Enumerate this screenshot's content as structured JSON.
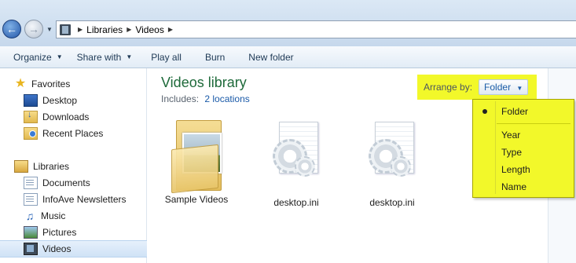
{
  "address": {
    "breadcrumb": [
      "Libraries",
      "Videos"
    ]
  },
  "toolbar": {
    "organize": "Organize",
    "share_with": "Share with",
    "play_all": "Play all",
    "burn": "Burn",
    "new_folder": "New folder"
  },
  "sidebar": {
    "favorites": "Favorites",
    "desktop": "Desktop",
    "downloads": "Downloads",
    "recent_places": "Recent Places",
    "libraries": "Libraries",
    "documents": "Documents",
    "infoave": "InfoAve Newsletters",
    "music": "Music",
    "pictures": "Pictures",
    "videos": "Videos"
  },
  "main": {
    "title": "Videos library",
    "includes_label": "Includes:",
    "includes_link": "2 locations",
    "arrange_label": "Arrange by:",
    "arrange_value": "Folder",
    "files": [
      {
        "name": "Sample Videos",
        "icon": "folder-icon"
      },
      {
        "name": "desktop.ini",
        "icon": "settings-file-icon"
      },
      {
        "name": "desktop.ini",
        "icon": "settings-file-icon"
      }
    ]
  },
  "menu": {
    "items": [
      "Folder",
      "Year",
      "Type",
      "Length",
      "Name"
    ],
    "selected": "Folder"
  },
  "colors": {
    "highlight": "#f2f82a",
    "title_green": "#1e6a3a",
    "link_blue": "#1a5aa8"
  }
}
